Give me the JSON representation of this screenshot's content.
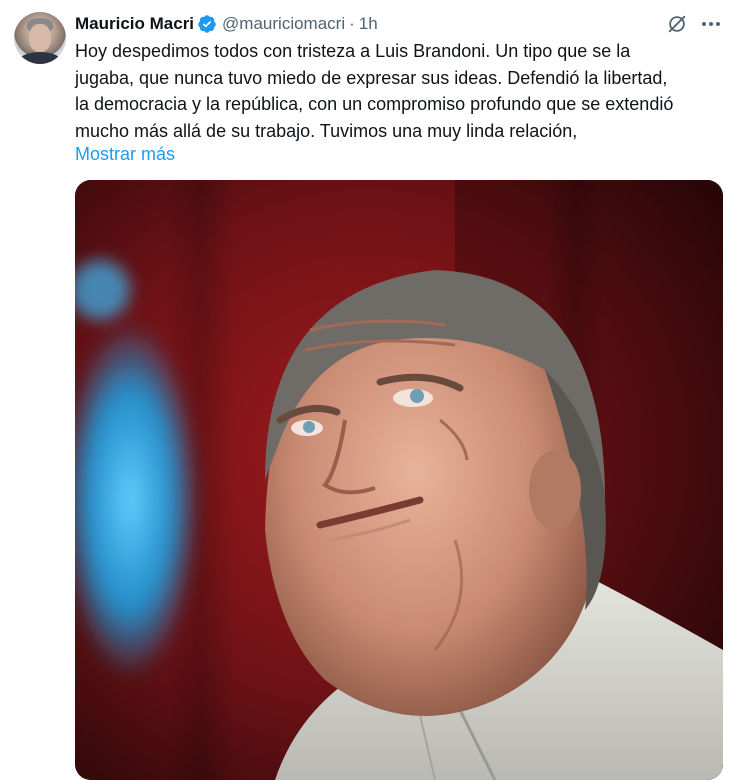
{
  "tweet": {
    "author": {
      "display_name": "Mauricio Macri",
      "handle": "@mauriciomacri",
      "verified_icon": "verified-badge-icon",
      "avatar_icon": "profile-avatar"
    },
    "separator": "·",
    "timestamp": "1h",
    "text_lines": [
      "Hoy despedimos todos con tristeza a Luis Brandoni. Un tipo que se la",
      "jugaba, que nunca tuvo miedo de expresar sus ideas. Defendió la libertad,",
      "la democracia y la república, con un compromiso profundo que se extendió",
      "mucho más allá de su trabajo. Tuvimos una muy linda relación,"
    ],
    "show_more_label": "Mostrar más",
    "actions": {
      "grok_icon": "grok-icon",
      "more_icon": "more-options-icon"
    },
    "media": {
      "kind": "photo",
      "subject": "portrait-photo"
    }
  },
  "colors": {
    "text_primary": "#0f1419",
    "text_secondary": "#536471",
    "link": "#1d9bf0",
    "verified": "#1d9bf0"
  }
}
